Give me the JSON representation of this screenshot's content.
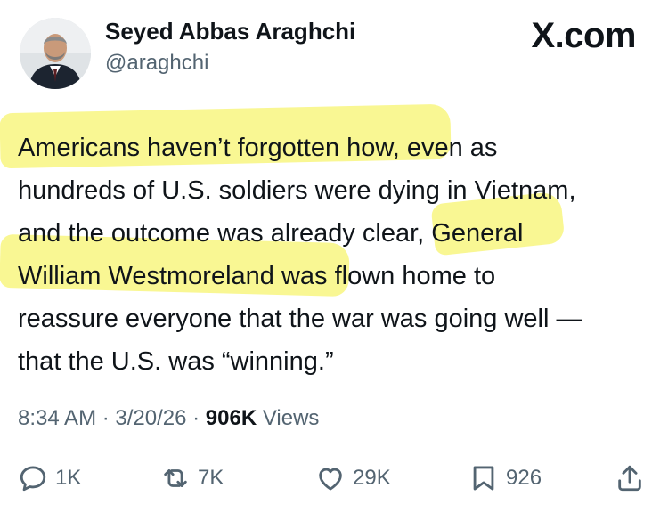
{
  "author": {
    "name": "Seyed Abbas Araghchi",
    "handle": "@araghchi"
  },
  "site": "X.com",
  "tweet": {
    "lines": [
      "Americans haven’t forgotten how, even as",
      "hundreds of U.S. soldiers were dying in Vietnam,",
      "and the outcome was already clear, General",
      "William Westmoreland was flown home to",
      "reassure everyone that the war was going well —",
      "that the U.S. was “winning.”"
    ]
  },
  "meta": {
    "time": "8:34 AM",
    "separator1": " · ",
    "date": "3/20/26",
    "separator2": " · ",
    "views_count": "906K",
    "views_label": " Views"
  },
  "actions": {
    "replies": "1K",
    "reposts": "7K",
    "likes": "29K",
    "bookmarks": "926"
  },
  "colors": {
    "highlight": "#f7f46f",
    "text": "#0f1419",
    "secondary": "#536471"
  },
  "icons": [
    "reply-icon",
    "repost-icon",
    "like-icon",
    "bookmark-icon",
    "share-icon"
  ]
}
